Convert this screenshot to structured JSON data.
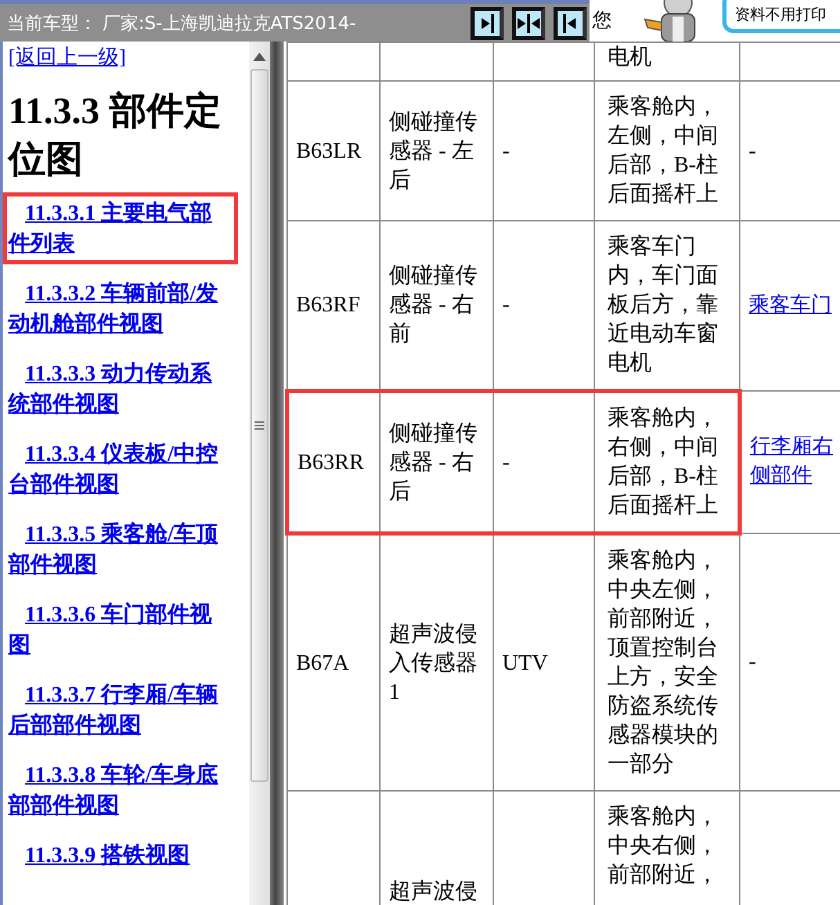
{
  "top_bar": {
    "model_label": "当前车型：",
    "model_value": "厂家:S-上海凯迪拉克ATS2014-",
    "greeting": "您",
    "bubble_text": "资料不用打印"
  },
  "sidebar": {
    "back_link": "[返回上一级]",
    "heading": "11.3.3 部件定位图",
    "items": [
      {
        "number": "11.3.3.1",
        "label": "主要电气部件列表",
        "highlighted": true
      },
      {
        "number": "11.3.3.2",
        "label": "车辆前部/发动机舱部件视图",
        "highlighted": false
      },
      {
        "number": "11.3.3.3",
        "label": "动力传动系统部件视图",
        "highlighted": false
      },
      {
        "number": "11.3.3.4",
        "label": "仪表板/中控台部件视图",
        "highlighted": false
      },
      {
        "number": "11.3.3.5",
        "label": "乘客舱/车顶部件视图",
        "highlighted": false
      },
      {
        "number": "11.3.3.6",
        "label": "车门部件视图",
        "highlighted": false
      },
      {
        "number": "11.3.3.7",
        "label": "行李厢/车辆后部部件视图",
        "highlighted": false
      },
      {
        "number": "11.3.3.8",
        "label": "车轮/车身底部部件视图",
        "highlighted": false
      },
      {
        "number": "11.3.3.9",
        "label": "搭铁视图",
        "highlighted": false
      }
    ]
  },
  "table": {
    "rows": [
      {
        "column_4": "电机",
        "highlighted": false,
        "partial": true
      },
      {
        "column_1": "B63LR",
        "column_2": "侧碰撞传感器 - 左后",
        "column_3": "-",
        "column_4": "乘客舱内，左侧，中间后部，B-柱后面摇杆上",
        "column_5": "-",
        "highlighted": false,
        "partial": false
      },
      {
        "column_1": "B63RF",
        "column_2": "侧碰撞传感器 - 右前",
        "column_3": "-",
        "column_4": "乘客车门内，车门面板后方，靠近电动车窗电机",
        "column_5_link": "乘客车门",
        "highlighted": false,
        "partial": false
      },
      {
        "column_1": "B63RR",
        "column_2": "侧碰撞传感器 - 右后",
        "column_3": "-",
        "column_4": "乘客舱内，右侧，中间后部，B-柱后面摇杆上",
        "column_5_link": "行李厢右侧部件",
        "highlighted": true,
        "partial": false
      },
      {
        "column_1": "B67A",
        "column_2": "超声波侵入传感器 1",
        "column_3": "UTV",
        "column_4": "乘客舱内，中央左侧，前部附近，顶置控制台上方，安全防盗系统传感器模块的一部分",
        "column_5": "-",
        "highlighted": false,
        "partial": false
      },
      {
        "column_2": "超声波侵",
        "column_4": "乘客舱内，中央右侧，前部附近，",
        "highlighted": false,
        "partial": true
      }
    ]
  }
}
